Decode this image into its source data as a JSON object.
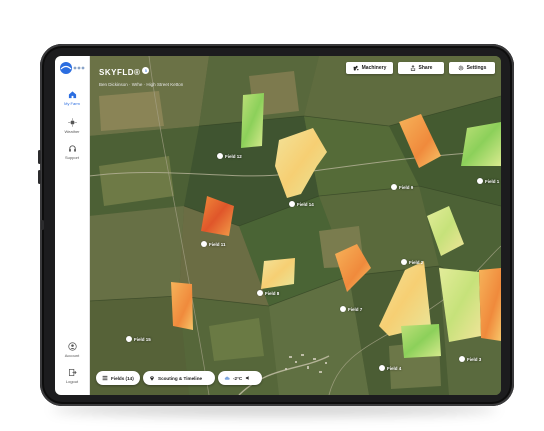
{
  "app": {
    "brand": "SKYFLD®",
    "badge": "5",
    "subtitle": "Ben Dickinson · Wrhe · High Street Ketton"
  },
  "sidebar": {
    "items": [
      {
        "label": "My Farm",
        "icon": "home-icon",
        "active": true
      },
      {
        "label": "Weather",
        "icon": "sun-icon",
        "active": false
      },
      {
        "label": "Support",
        "icon": "headset-icon",
        "active": false
      },
      {
        "label": "Account",
        "icon": "account-icon",
        "active": false
      },
      {
        "label": "Logout",
        "icon": "logout-icon",
        "active": false
      }
    ]
  },
  "toolbar": {
    "machinery": "Machinery",
    "share": "Share",
    "settings": "Settings"
  },
  "bottom_bar": {
    "fields": "Fields (14)",
    "scouting": "Scouting & Timeline",
    "weather": "-2°C"
  },
  "fields": [
    "Field 12",
    "Field 14",
    "Field 9",
    "Field 15",
    "Field 11",
    "Field 2",
    "Field 8",
    "Field 7",
    "Field 13",
    "Field 1",
    "Field 3",
    "Field 4"
  ],
  "colors": {
    "accent": "#2b6de0",
    "sidebar_bg": "#ffffff",
    "map_base": "#4a5a32"
  }
}
